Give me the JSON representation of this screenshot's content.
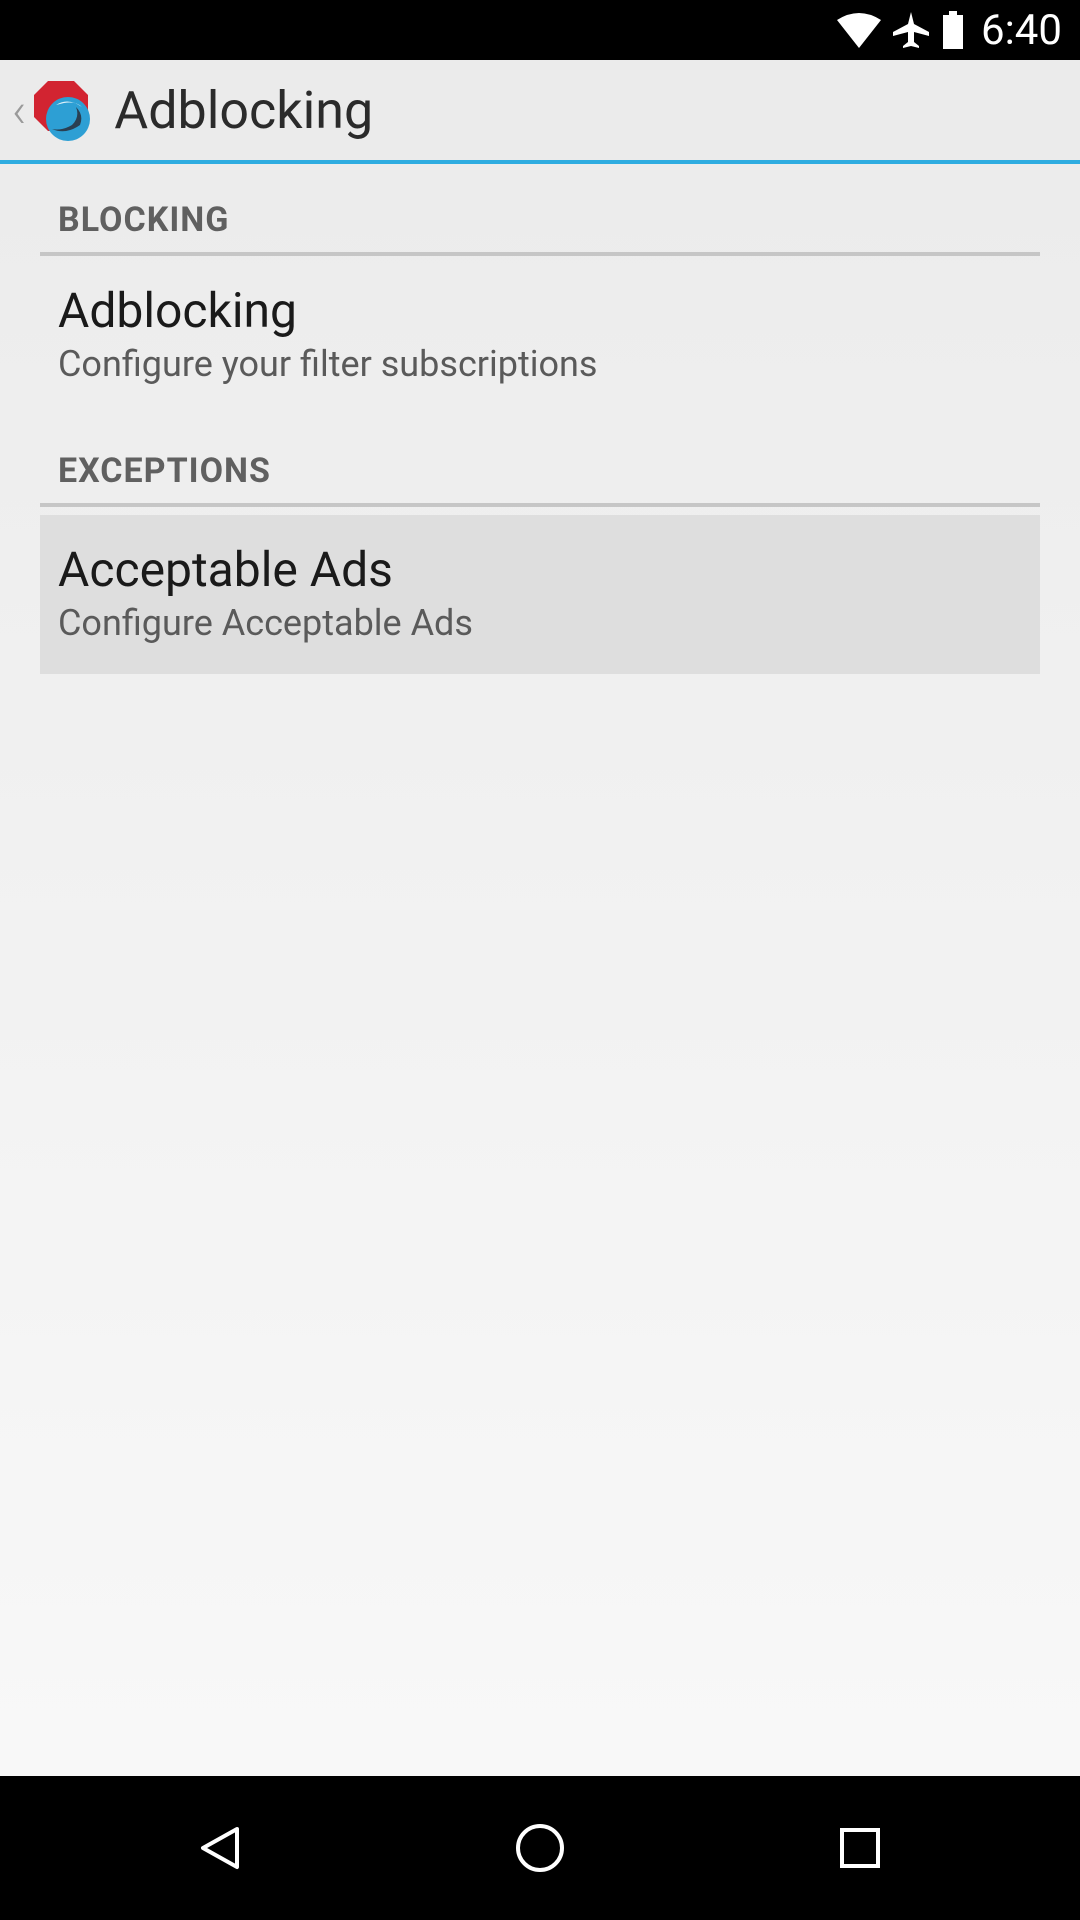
{
  "status_bar": {
    "time": "6:40"
  },
  "app_bar": {
    "title": "Adblocking"
  },
  "sections": [
    {
      "header": "BLOCKING",
      "items": [
        {
          "title": "Adblocking",
          "subtitle": "Configure your filter subscriptions",
          "highlighted": false
        }
      ]
    },
    {
      "header": "EXCEPTIONS",
      "items": [
        {
          "title": "Acceptable Ads",
          "subtitle": "Configure Acceptable Ads",
          "highlighted": true
        }
      ]
    }
  ]
}
